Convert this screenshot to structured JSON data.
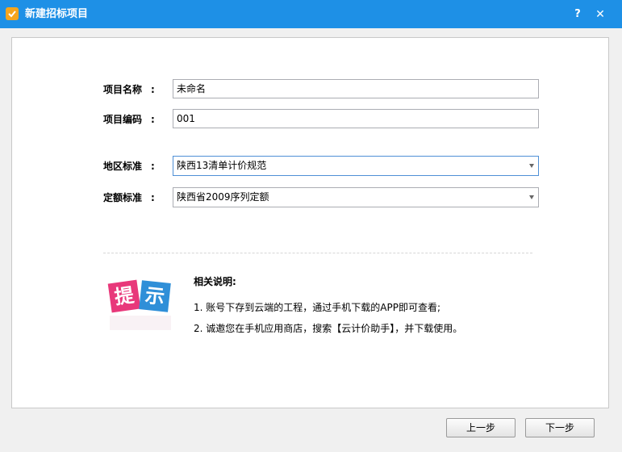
{
  "window": {
    "title": "新建招标项目",
    "help_label": "?",
    "close_label": "✕"
  },
  "form": {
    "project_name": {
      "label": "项目名称",
      "colon": ":",
      "value": "未命名"
    },
    "project_code": {
      "label": "项目编码",
      "colon": ":",
      "value": "001"
    },
    "region_standard": {
      "label": "地区标准",
      "colon": ":",
      "value": "陕西13清单计价规范"
    },
    "quota_standard": {
      "label": "定额标准",
      "colon": ":",
      "value": "陕西省2009序列定额"
    }
  },
  "tip": {
    "graphic_chars": [
      "提",
      "示"
    ],
    "heading": "相关说明:",
    "items": [
      "1. 账号下存到云端的工程，通过手机下载的APP即可查看;",
      "2. 诚邀您在手机应用商店，搜索【云计价助手】，并下载使用。"
    ]
  },
  "buttons": {
    "prev_label": "上一步",
    "next_label": "下一步"
  },
  "colors": {
    "titlebar": "#1e90e6",
    "tip_pink": "#e8387a",
    "tip_blue": "#2f8fd8"
  }
}
